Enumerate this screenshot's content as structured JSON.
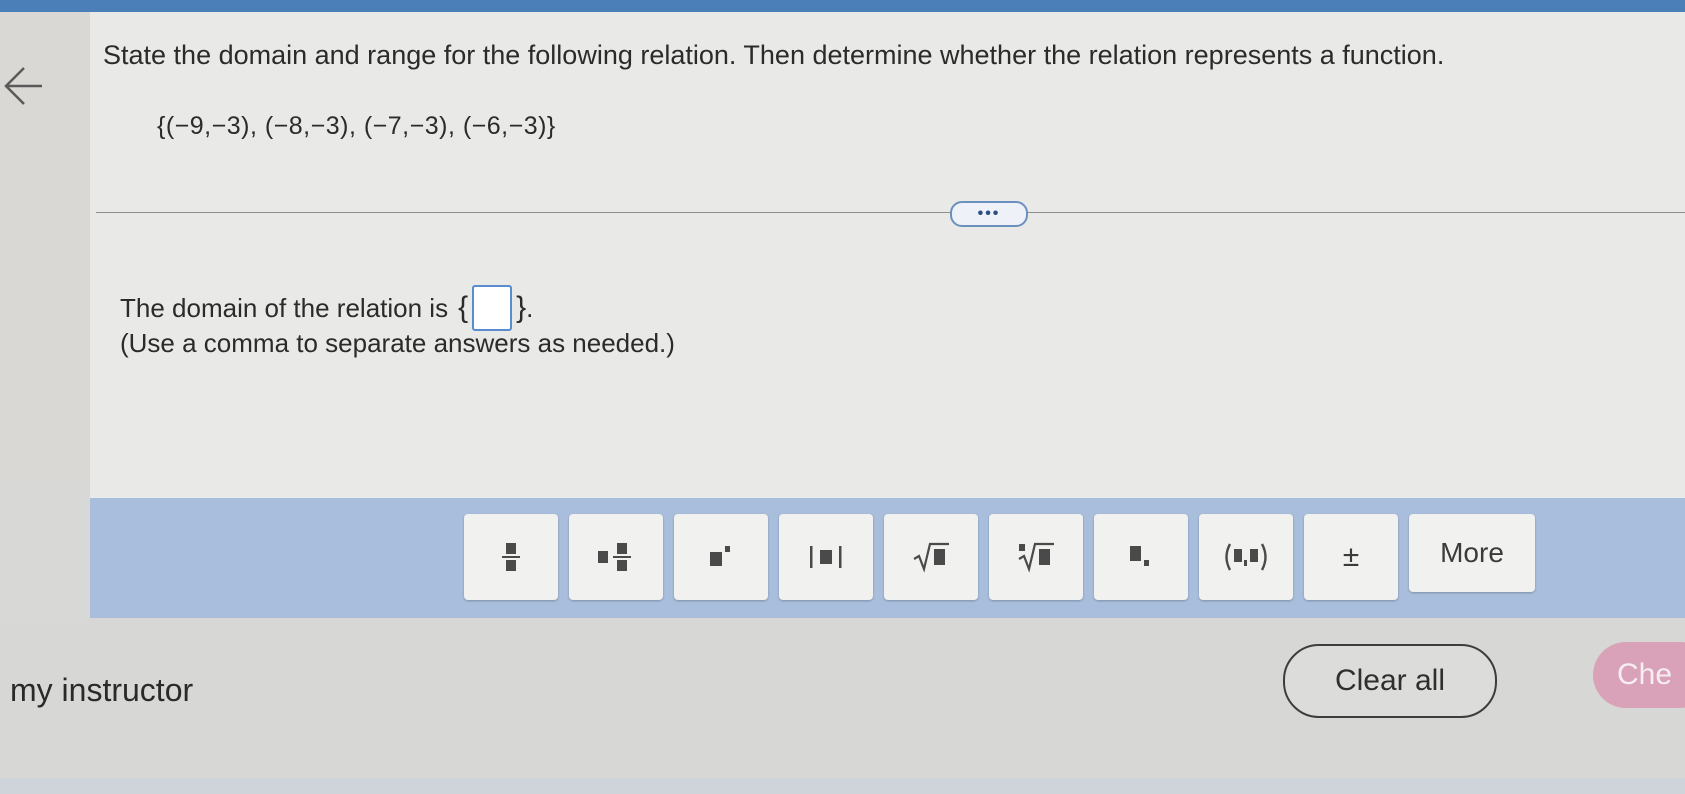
{
  "question": {
    "prompt": "State the domain and range for the following relation. Then determine whether the relation represents a function.",
    "relation": "{(−9,−3), (−8,−3), (−7,−3), (−6,−3)}"
  },
  "expand_button": {
    "label": "•••"
  },
  "answer": {
    "prefix": "The domain of the relation is",
    "open_brace": "{",
    "close_brace": "}",
    "suffix": ".",
    "value": "",
    "hint": "(Use a comma to separate answers as needed.)"
  },
  "math_toolbar": {
    "tools": [
      {
        "name": "fraction",
        "icon": "fraction-icon"
      },
      {
        "name": "mixed-number",
        "icon": "mixed-number-icon"
      },
      {
        "name": "exponent",
        "icon": "exponent-icon"
      },
      {
        "name": "absolute-value",
        "icon": "absolute-value-icon"
      },
      {
        "name": "square-root",
        "icon": "square-root-icon"
      },
      {
        "name": "nth-root",
        "icon": "nth-root-icon"
      },
      {
        "name": "subscript",
        "icon": "subscript-icon"
      },
      {
        "name": "ordered-pair",
        "icon": "ordered-pair-icon"
      },
      {
        "name": "plus-minus",
        "label": "±"
      }
    ],
    "more_label": "More"
  },
  "footer": {
    "instructor_text": "my instructor",
    "clear_all_label": "Clear all",
    "check_label": "Che"
  },
  "colors": {
    "accent": "#4a7fb8",
    "toolbar_bg": "#a9bedc",
    "check_button": "#d9a2b8"
  }
}
